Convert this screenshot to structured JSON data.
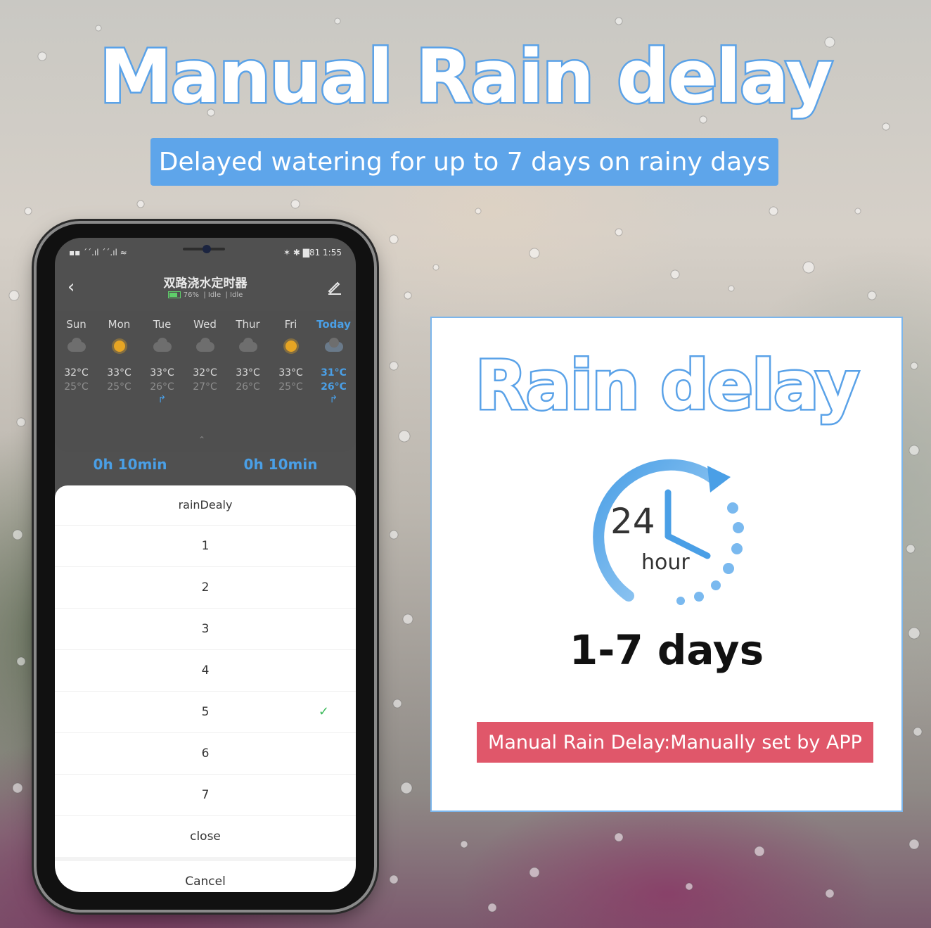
{
  "banner": {
    "headline": "Manual Rain delay",
    "subtitle": "Delayed watering for up to 7 days on rainy days"
  },
  "phone": {
    "status_left": "▪▪ ´´.ıl ´´.ıl ≈",
    "status_right": "✶ ✱ ▇81 1:55",
    "app": {
      "title": "双路浇水定时器",
      "battery": "76%",
      "state1": "Idle",
      "state2": "Idle"
    },
    "forecast": [
      {
        "day": "Sun",
        "icon": "cloud-icon",
        "hi": "32°C",
        "lo": "25°C",
        "rain": ""
      },
      {
        "day": "Mon",
        "icon": "sun-icon",
        "hi": "33°C",
        "lo": "25°C",
        "rain": ""
      },
      {
        "day": "Tue",
        "icon": "cloud-icon",
        "hi": "33°C",
        "lo": "26°C",
        "rain": "↱"
      },
      {
        "day": "Wed",
        "icon": "cloud-icon",
        "hi": "32°C",
        "lo": "27°C",
        "rain": ""
      },
      {
        "day": "Thur",
        "icon": "cloud-icon",
        "hi": "33°C",
        "lo": "26°C",
        "rain": ""
      },
      {
        "day": "Fri",
        "icon": "sun-icon",
        "hi": "33°C",
        "lo": "25°C",
        "rain": ""
      },
      {
        "day": "Today",
        "icon": "rain-cloud-icon",
        "hi": "31°C",
        "lo": "26°C",
        "rain": "↱"
      }
    ],
    "durations": [
      "0h 10min",
      "0h 10min"
    ],
    "sheet": {
      "title": "rainDealy",
      "options": [
        "1",
        "2",
        "3",
        "4",
        "5",
        "6",
        "7"
      ],
      "selected": "5",
      "close": "close",
      "cancel": "Cancel"
    },
    "colors": {
      "accent": "#4a9fe6",
      "check": "#3cba5a"
    }
  },
  "card": {
    "title": "Rain delay",
    "clock_number": "24",
    "clock_unit": "hour",
    "range": "1-7 days",
    "note": "Manual Rain Delay:Manually set by APP",
    "colors": {
      "title_stroke": "#5aa2e8",
      "note_bg": "#e0576a"
    }
  }
}
